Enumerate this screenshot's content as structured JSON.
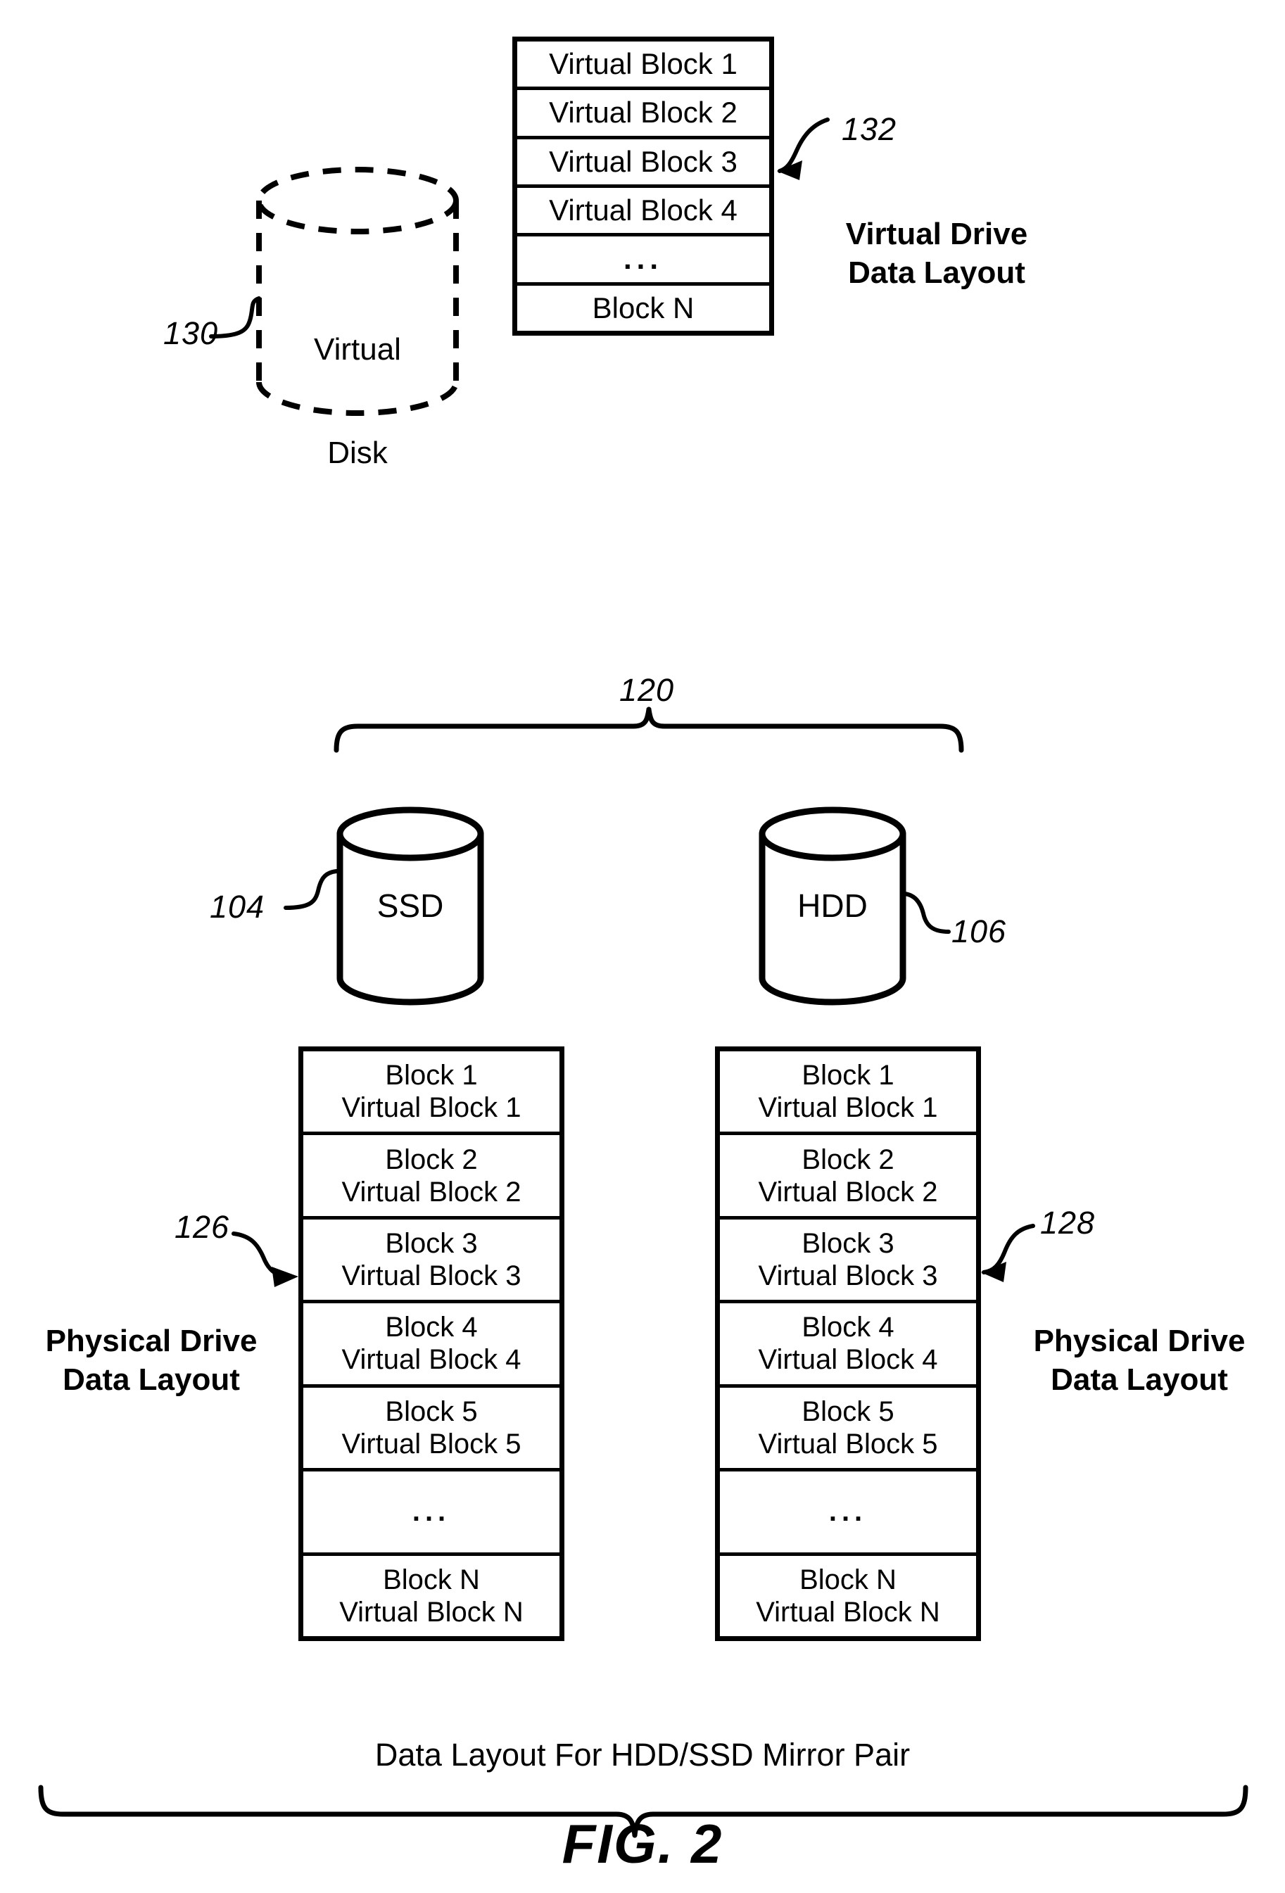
{
  "figure": {
    "label": "FIG. 2",
    "caption": "Data Layout For HDD/SSD Mirror Pair"
  },
  "virtual_section": {
    "disk": {
      "line1": "Virtual",
      "line2": "Disk",
      "reference": "130"
    },
    "table": {
      "reference": "132",
      "rows": [
        "Virtual Block 1",
        "Virtual Block 2",
        "Virtual Block 3",
        "Virtual Block 4",
        "...",
        "Block N"
      ]
    },
    "title": "Virtual Drive\nData Layout"
  },
  "physical_section": {
    "group_reference": "120",
    "drives": [
      {
        "name": "SSD",
        "reference": "104"
      },
      {
        "name": "HDD",
        "reference": "106"
      }
    ],
    "ssd_layout": {
      "reference": "126",
      "title": "Physical Drive\nData Layout",
      "rows": [
        "Block 1\nVirtual Block 1",
        "Block 2\nVirtual Block 2",
        "Block 3\nVirtual Block 3",
        "Block 4\nVirtual Block 4",
        "Block 5\nVirtual Block 5",
        "...",
        "Block N\nVirtual Block N"
      ]
    },
    "hdd_layout": {
      "reference": "128",
      "title": "Physical Drive\nData Layout",
      "rows": [
        "Block 1\nVirtual Block 1",
        "Block 2\nVirtual Block 2",
        "Block 3\nVirtual Block 3",
        "Block 4\nVirtual Block 4",
        "Block 5\nVirtual Block 5",
        "...",
        "Block N\nVirtual Block N"
      ]
    }
  },
  "colors": {
    "ink": "#000000",
    "paper": "#ffffff"
  }
}
